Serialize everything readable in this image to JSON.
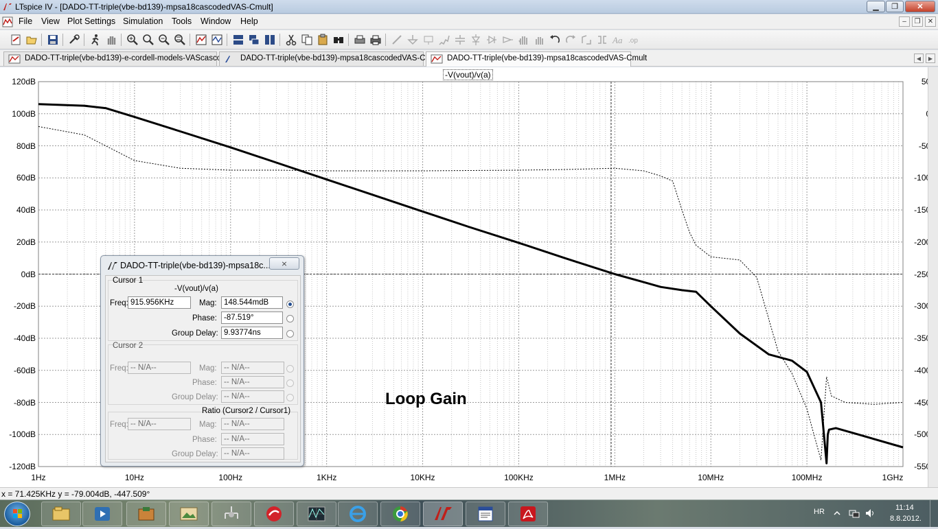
{
  "window": {
    "title": "LTspice IV - [DADO-TT-triple(vbe-bd139)-mpsa18cascodedVAS-Cmult]"
  },
  "menu": {
    "items": [
      "File",
      "View",
      "Plot Settings",
      "Simulation",
      "Tools",
      "Window",
      "Help"
    ]
  },
  "toolbar": {
    "icons": [
      "new-schematic-icon",
      "open-icon",
      "save-icon",
      "control-panel-icon",
      "run-icon",
      "halt-icon",
      "zoom-in-icon",
      "zoom-box-icon",
      "zoom-out-icon",
      "zoom-fit-icon",
      "autorange-icon",
      "tile-horizontal-icon",
      "cascade-icon",
      "tile-vertical-icon",
      "cut-icon",
      "copy-icon",
      "paste-icon",
      "find-icon",
      "print-icon",
      "print-preview-icon",
      "wire-icon",
      "ground-icon",
      "label-icon",
      "resistor-icon",
      "capacitor-icon",
      "diode-icon",
      "component-icon",
      "move-icon",
      "drag-icon",
      "undo-icon",
      "redo-icon",
      "rotate-icon",
      "mirror-icon",
      "text-icon",
      "spice-directive-icon"
    ]
  },
  "tabs": [
    {
      "label": "DADO-TT-triple(vbe-bd139)-e-cordell-models-VAScascoded",
      "icon": "waveform-icon"
    },
    {
      "label": "DADO-TT-triple(vbe-bd139)-mpsa18cascodedVAS-Cmult",
      "icon": "schematic-icon"
    },
    {
      "label": "DADO-TT-triple(vbe-bd139)-mpsa18cascodedVAS-Cmult",
      "icon": "waveform-icon",
      "active": true
    }
  ],
  "plot": {
    "trace_label": "-V(vout)/v(a)",
    "annotation": "Loop Gain",
    "left_axis_ticks": [
      "120dB",
      "100dB",
      "80dB",
      "60dB",
      "40dB",
      "20dB",
      "0dB",
      "-20dB",
      "-40dB",
      "-60dB",
      "-80dB",
      "-100dB",
      "-120dB"
    ],
    "right_axis_ticks": [
      "50°",
      "0°",
      "-50°",
      "-100°",
      "-150°",
      "-200°",
      "-250°",
      "-300°",
      "-350°",
      "-400°",
      "-450°",
      "-500°",
      "-550°"
    ],
    "bottom_axis_ticks": [
      "1Hz",
      "10Hz",
      "100Hz",
      "1KHz",
      "10KHz",
      "100KHz",
      "1MHz",
      "10MHz",
      "100MHz",
      "1GHz"
    ],
    "colors": {
      "trace": "#000000",
      "grid": "#9a9a9a",
      "background": "#ffffff"
    }
  },
  "chart_data": {
    "type": "line",
    "title": "-V(vout)/v(a)",
    "xlabel": "",
    "ylabel": "",
    "x_scale": "log",
    "xlim": [
      1,
      1000000000
    ],
    "ylim": [
      -120,
      120
    ],
    "y2lim": [
      -550,
      50
    ],
    "grid": true,
    "series": [
      {
        "style": "solid",
        "axis": "left",
        "x": [
          1,
          3,
          5,
          10,
          30,
          100,
          300,
          1000,
          3000,
          10000,
          30000,
          100000,
          300000,
          1000000,
          2000000,
          3000000,
          5000000,
          7000000,
          10000000,
          20000000,
          40000000,
          70000000,
          100000000,
          140000000,
          160000000,
          165000000,
          170000000,
          200000000,
          300000000,
          1000000000
        ],
        "y": [
          106,
          105,
          103.5,
          98,
          89,
          79,
          69.5,
          59,
          49.5,
          39,
          29.5,
          19.5,
          10,
          0,
          -5,
          -8,
          -10,
          -11,
          -20,
          -37,
          -50,
          -54,
          -61,
          -80,
          -118,
          -100,
          -97,
          -96,
          -99,
          -108
        ]
      },
      {
        "style": "dashed",
        "axis": "right",
        "x": [
          1,
          3,
          10,
          30,
          100,
          300,
          1000,
          10000,
          100000,
          300000,
          1000000,
          2000000,
          3000000,
          4000000,
          5000000,
          6000000,
          7000000,
          10000000,
          20000000,
          30000000,
          50000000,
          70000000,
          100000000,
          140000000,
          160000000,
          170000000,
          180000000,
          250000000,
          500000000,
          1000000000
        ],
        "y": [
          -20,
          -33,
          -73,
          -85,
          -88,
          -88,
          -89,
          -89,
          -88,
          -87,
          -85,
          -89,
          -97,
          -105,
          -150,
          -185,
          -205,
          -223,
          -228,
          -255,
          -370,
          -405,
          -460,
          -540,
          -410,
          -425,
          -440,
          -450,
          -453,
          -450
        ]
      }
    ]
  },
  "cursor_dialog": {
    "title": "DADO-TT-triple(vbe-bd139)-mpsa18c...",
    "close_label": "⨯",
    "cursor1": {
      "group_label": "Cursor 1",
      "trace": "-V(vout)/v(a)",
      "freq_label": "Freq:",
      "freq": "915.956KHz",
      "mag_label": "Mag:",
      "mag": "148.544mdB",
      "phase_label": "Phase:",
      "phase": "-87.519°",
      "gd_label": "Group Delay:",
      "gd": "9.93774ns"
    },
    "cursor2": {
      "group_label": "Cursor 2",
      "freq_label": "Freq:",
      "freq": "-- N/A--",
      "mag_label": "Mag:",
      "mag": "-- N/A--",
      "phase_label": "Phase:",
      "phase": "-- N/A--",
      "gd_label": "Group Delay:",
      "gd": "-- N/A--"
    },
    "ratio": {
      "group_label": "Ratio (Cursor2 / Cursor1)",
      "freq_label": "Freq:",
      "freq": "-- N/A--",
      "mag_label": "Mag:",
      "mag": "-- N/A--",
      "phase_label": "Phase:",
      "phase": "-- N/A--",
      "gd_label": "Group Delay:",
      "gd": "-- N/A--"
    }
  },
  "status": {
    "text": "x = 71.425KHz   y = -79.004dB, -447.509°"
  },
  "taskbar": {
    "apps": [
      "explorer-icon",
      "media-player-icon",
      "package-icon",
      "photo-viewer-icon",
      "network-icon",
      "antivirus-icon",
      "oscilloscope-icon",
      "internet-explorer-icon",
      "chrome-icon",
      "ltspice-icon",
      "wordpad-icon",
      "pdf-reader-icon"
    ],
    "language": "HR",
    "time": "11:14",
    "date": "8.8.2012."
  }
}
